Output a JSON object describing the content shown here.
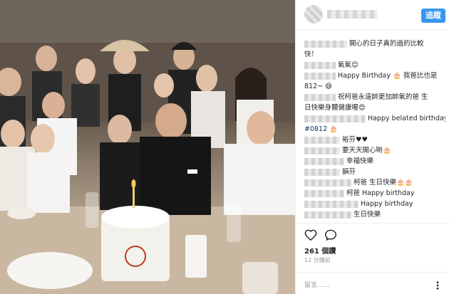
{
  "photo": {
    "alt_icon": "group-photo-image"
  },
  "header": {
    "follow_label": "追蹤"
  },
  "comments": [
    {
      "name_hidden": true,
      "text": "開心的日子真的過的比較"
    },
    {
      "name_hidden": false,
      "text": "快！"
    },
    {
      "name_hidden": true,
      "text": "氣氣😊"
    },
    {
      "name_hidden": true,
      "text": "Happy Birthday 🎂 我爸比也是"
    },
    {
      "name_hidden": false,
      "text": "812~ 😄"
    },
    {
      "name_hidden": true,
      "text": "祝柯爸永遠帥更加帥氣的爸 生"
    },
    {
      "name_hidden": false,
      "text": "日快樂身體健康喔😍"
    },
    {
      "name_hidden": true,
      "text": "Happy belated birthdayy"
    },
    {
      "name_hidden": false,
      "text": "#0812 🎂"
    },
    {
      "name_hidden": true,
      "text": "裕芬♥♥"
    },
    {
      "name_hidden": true,
      "text": "要天天開心喲🎂"
    },
    {
      "name_hidden": true,
      "text": "幸福快樂"
    },
    {
      "name_hidden": true,
      "text": "韻芬"
    },
    {
      "name_hidden": true,
      "text": "柯爸 生日快樂🎂🎂"
    },
    {
      "name_hidden": true,
      "text": "柯爸 Happy birthday"
    },
    {
      "name_hidden": true,
      "text": "Happy birthday"
    },
    {
      "name_hidden": true,
      "text": "生日快樂"
    }
  ],
  "actions": {
    "likes": "261 個讚",
    "time": "12 分鐘前",
    "comment_placeholder": "留言……"
  },
  "colors": {
    "accent": "#3897f0",
    "text": "#262626",
    "muted": "#999999"
  }
}
